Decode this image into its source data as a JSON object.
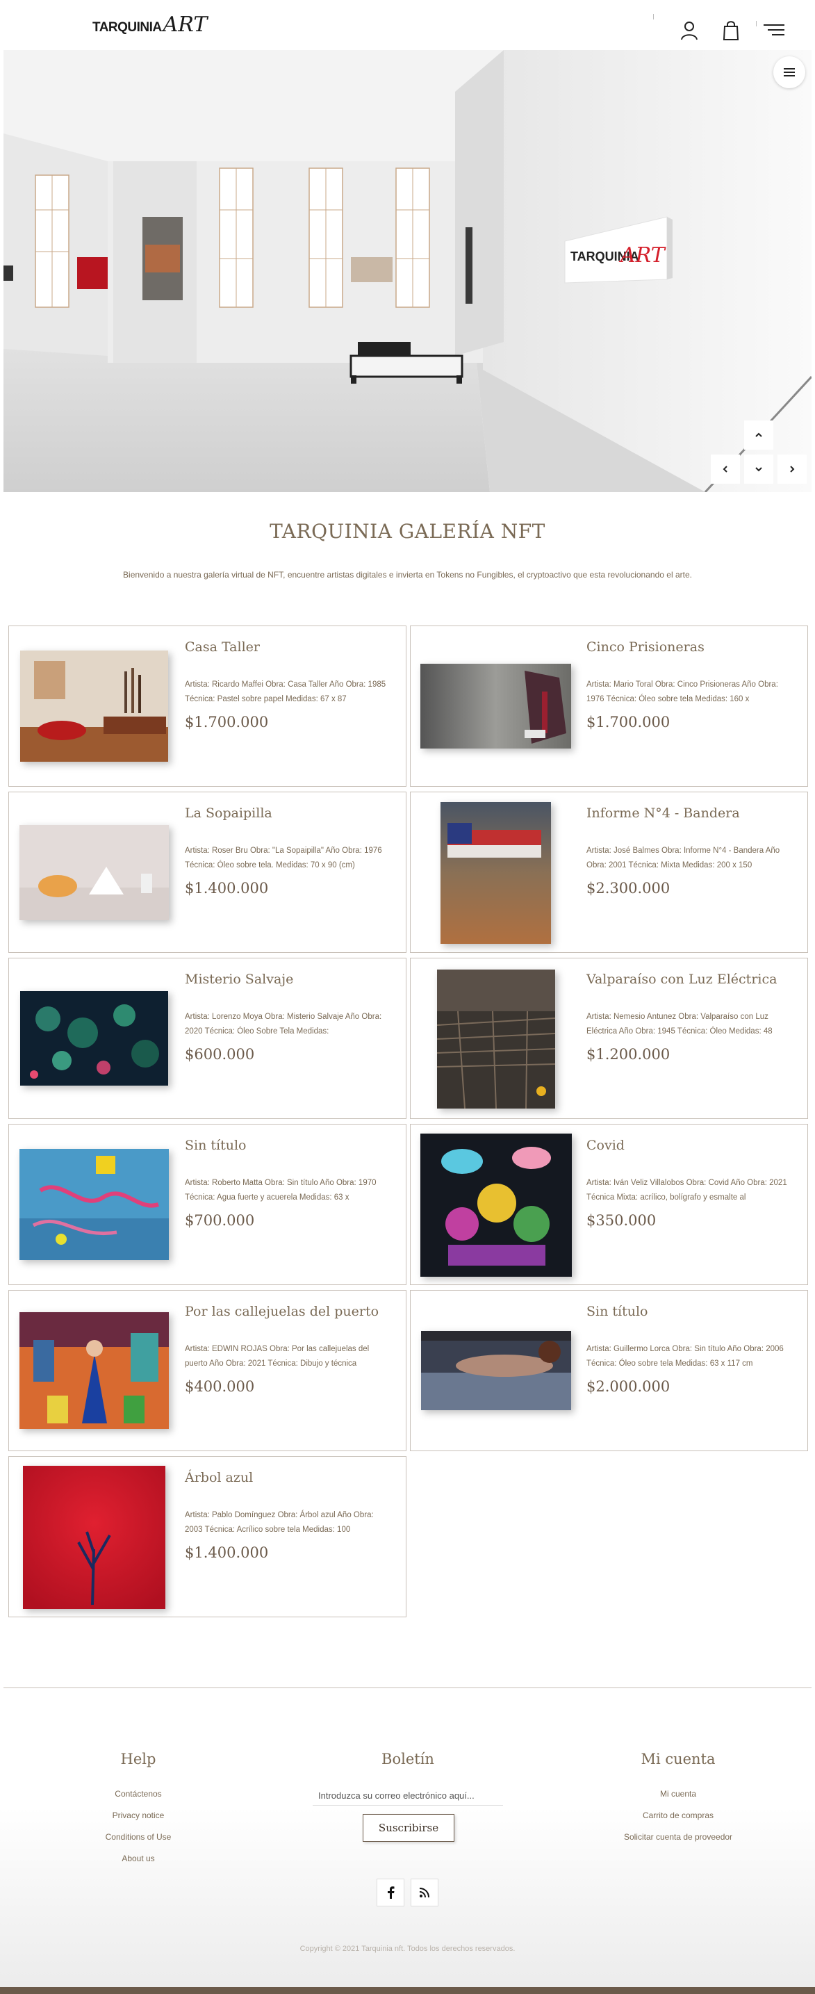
{
  "header": {
    "logo_main": "TARQUINIA",
    "logo_art": "ART",
    "icons": [
      "user-icon",
      "shopping-bag-icon",
      "menu-lines-icon"
    ]
  },
  "hero": {
    "sign_main": "TARQUINIA",
    "sign_art": "ART"
  },
  "intro": {
    "title": "TARQUINIA GALERÍA NFT",
    "text": "Bienvenido a nuestra galería virtual de NFT, encuentre artistas digitales e invierta en Tokens no Fungibles, el cryptoactivo que esta revolucionando el arte."
  },
  "products": [
    {
      "title": "Casa Taller",
      "desc": "Artista: Ricardo Maffei Obra: Casa Taller Año Obra: 1985 Técnica: Pastel sobre papel Medidas: 67 x 87",
      "price": "$1.700.000"
    },
    {
      "title": "Cinco Prisioneras",
      "desc": "Artista: Mario Toral Obra: Cinco Prisioneras Año Obra: 1976 Técnica: Óleo sobre tela Medidas: 160 x",
      "price": "$1.700.000"
    },
    {
      "title": "La Sopaipilla",
      "desc": "Artista: Roser Bru Obra: \"La Sopaipilla\" Año Obra: 1976 Técnica: Óleo sobre tela. Medidas: 70 x 90 (cm)",
      "price": "$1.400.000"
    },
    {
      "title": "Informe N°4 - Bandera",
      "desc": "Artista: José Balmes Obra: Informe N°4 - Bandera Año Obra: 2001 Técnica: Mixta Medidas: 200 x 150",
      "price": "$2.300.000"
    },
    {
      "title": "Misterio Salvaje",
      "desc": "Artista: Lorenzo Moya Obra: Misterio Salvaje Año Obra: 2020 Técnica: Óleo Sobre Tela Medidas:",
      "price": "$600.000"
    },
    {
      "title": "Valparaíso con Luz Eléctrica",
      "desc": "Artista: Nemesio Antunez Obra: Valparaíso con Luz Eléctrica Año Obra: 1945 Técnica: Óleo Medidas: 48",
      "price": "$1.200.000"
    },
    {
      "title": "Sin título",
      "desc": "Artista: Roberto Matta Obra: Sin título Año Obra: 1970 Técnica: Agua fuerte y acuerela Medidas: 63 x",
      "price": "$700.000"
    },
    {
      "title": "Covid",
      "desc": "Artista: Iván Veliz Villalobos Obra: Covid Año Obra: 2021 Técnica Mixta: acrílico, bolígrafo y esmalte al",
      "price": "$350.000"
    },
    {
      "title": "Por las callejuelas del puerto",
      "desc": "Artista: EDWIN ROJAS Obra: Por las callejuelas del puerto Año Obra: 2021 Técnica: Dibujo y técnica",
      "price": "$400.000"
    },
    {
      "title": "Sin título",
      "desc": "Artista: Guillermo Lorca Obra: Sin título Año Obra: 2006 Técnica: Óleo sobre tela Medidas: 63 x 117 cm",
      "price": "$2.000.000"
    },
    {
      "title": "Árbol azul",
      "desc": "Artista: Pablo Domínguez Obra: Árbol azul Año Obra: 2003 Técnica: Acrílico sobre tela Medidas: 100",
      "price": "$1.400.000"
    }
  ],
  "footer": {
    "help": {
      "title": "Help",
      "links": [
        "Contáctenos",
        "Privacy notice",
        "Conditions of Use",
        "About us"
      ]
    },
    "newsletter": {
      "title": "Boletín",
      "placeholder": "Introduzca su correo electrónico aquí...",
      "button": "Suscribirse"
    },
    "account": {
      "title": "Mi cuenta",
      "links": [
        "Mi cuenta",
        "Carrito de compras",
        "Solicitar cuenta de proveedor"
      ]
    },
    "social_icons": [
      "facebook-icon",
      "rss-icon"
    ],
    "copyright": "Copyright © 2021 Tarquinia nft. Todos los derechos reservados."
  }
}
